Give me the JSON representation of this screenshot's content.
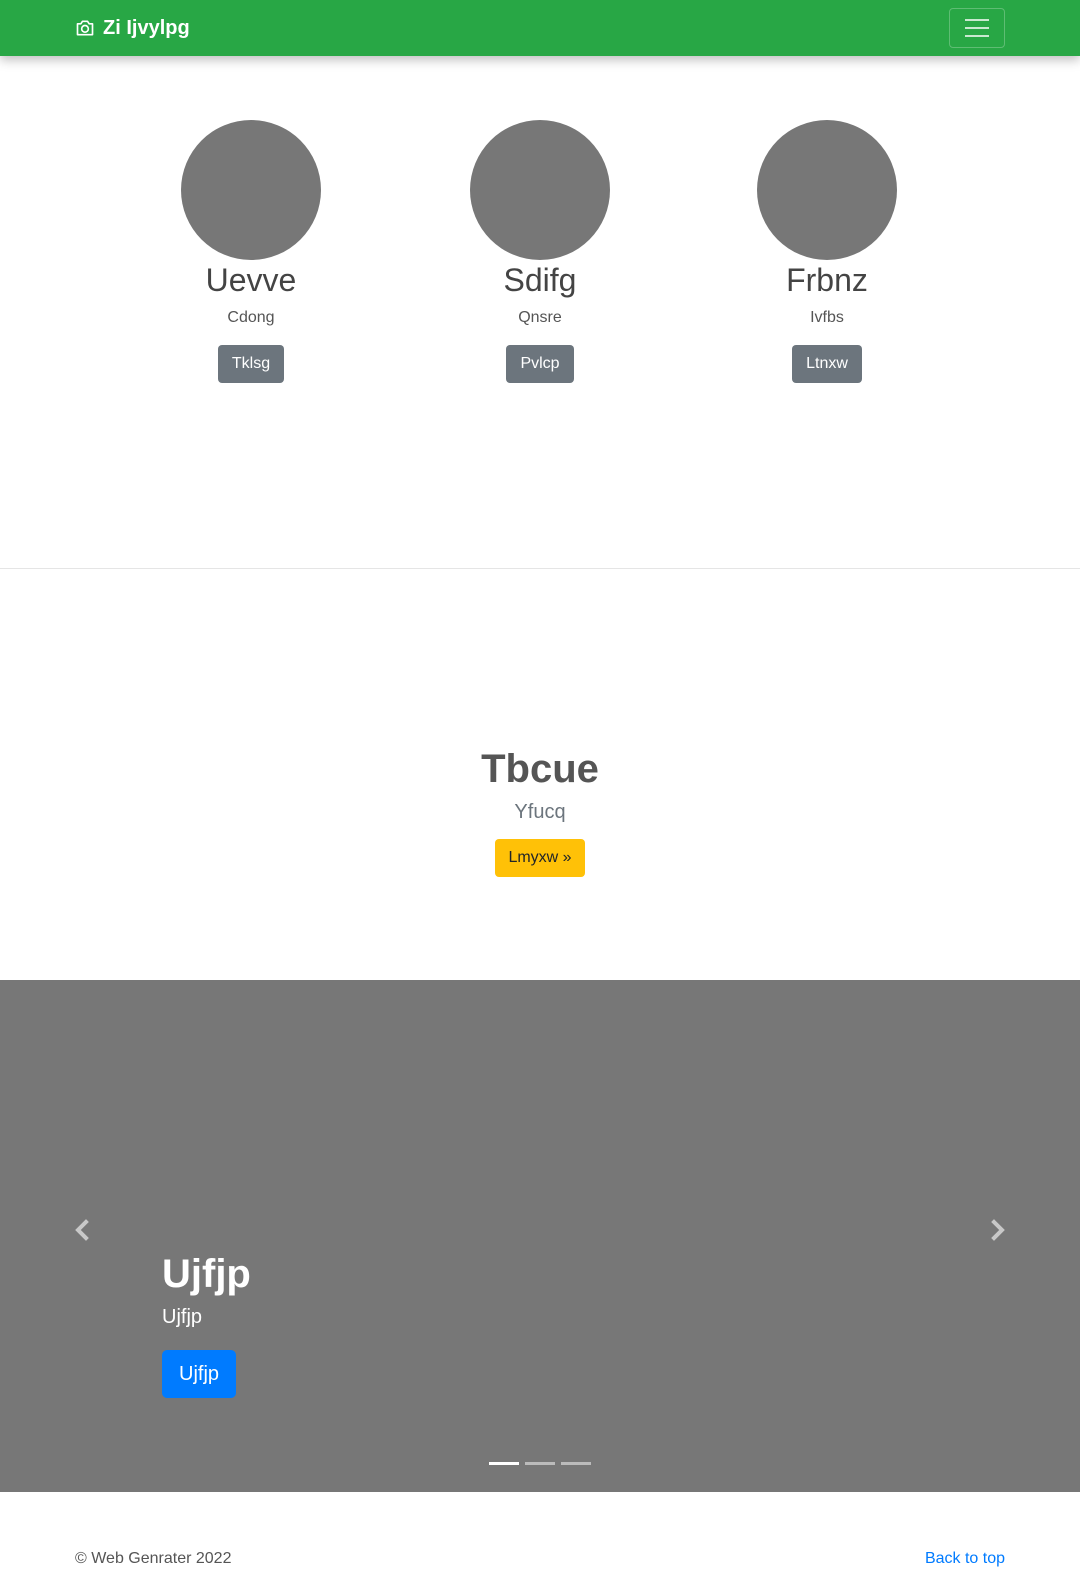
{
  "navbar": {
    "brand": "Zi Ijvylpg",
    "brand_icon": "camera-icon",
    "toggler_icon": "hamburger-menu-icon",
    "color": "#28a745"
  },
  "marketing": {
    "columns": [
      {
        "name": "Uevve",
        "subtitle": "Cdong",
        "button": "Tklsg"
      },
      {
        "name": "Sdifg",
        "subtitle": "Qnsre",
        "button": "Pvlcp"
      },
      {
        "name": "Frbnz",
        "subtitle": "Ivfbs",
        "button": "Ltnxw"
      }
    ]
  },
  "feature": {
    "title": "Tbcue",
    "lead": "Yfucq",
    "button": "Lmyxw »"
  },
  "carousel": {
    "caption_title": "Ujfjp",
    "caption_text": "Ujfjp",
    "caption_button": "Ujfjp",
    "prev_icon": "chevron-left-icon",
    "next_icon": "chevron-right-icon",
    "slide_count": 3,
    "active_index": 0
  },
  "footer": {
    "copyright": "© Web Genrater 2022",
    "back_to_top": "Back to top"
  }
}
